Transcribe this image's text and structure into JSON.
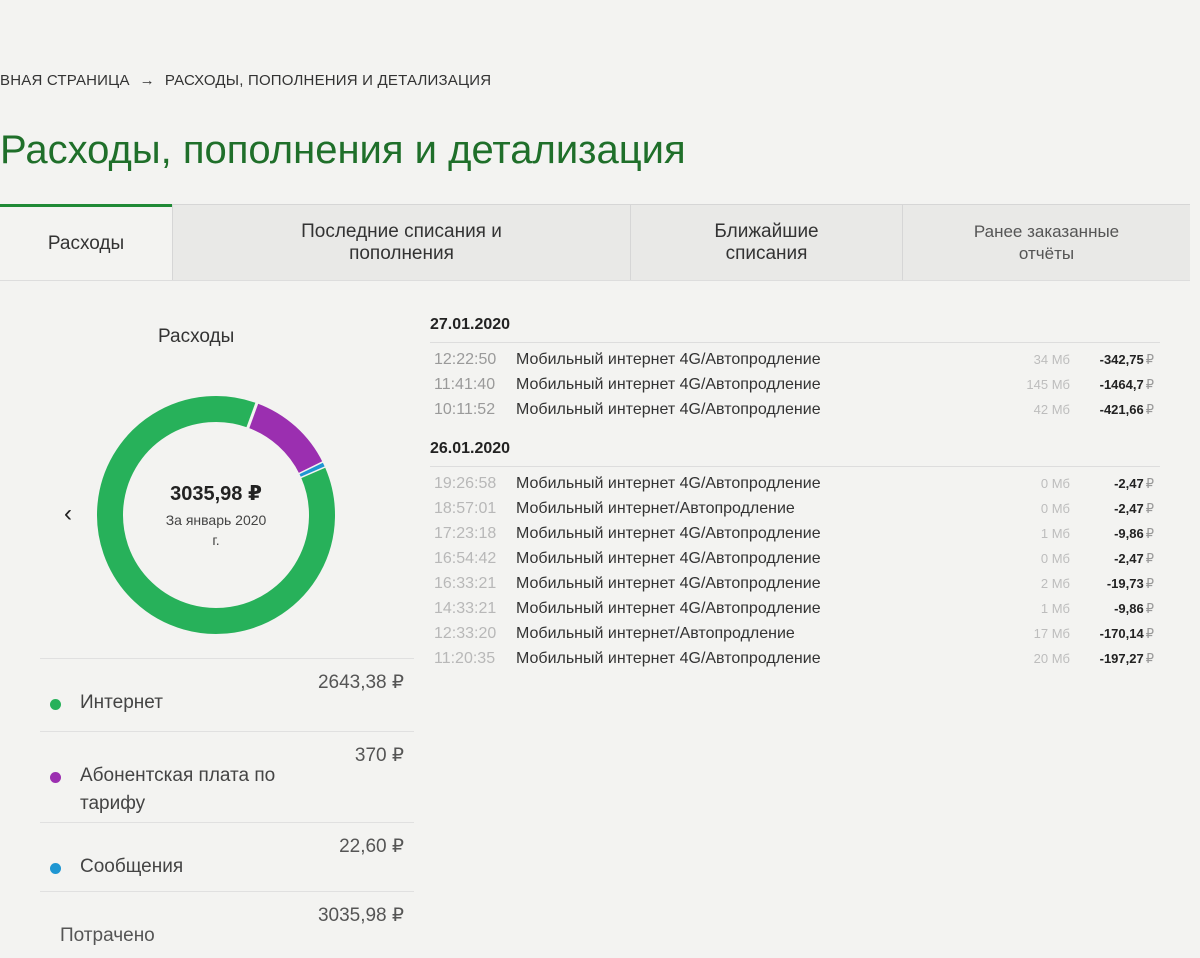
{
  "breadcrumb": {
    "home": "ВНАЯ СТРАНИЦА",
    "separator": "→",
    "current": "РАСХОДЫ, ПОПОЛНЕНИЯ И ДЕТАЛИЗАЦИЯ"
  },
  "page_title": "Расходы, пополнения и детализация",
  "tabs": [
    {
      "line1": "Расходы",
      "line2": ""
    },
    {
      "line1": "Последние списания и",
      "line2": "пополнения"
    },
    {
      "line1": "Ближайшие",
      "line2": "списания"
    },
    {
      "line1": "Ранее заказанные",
      "line2": "отчёты"
    }
  ],
  "summary": {
    "title": "Расходы",
    "total": "3035,98 ₽",
    "period": "За январь 2020 г.",
    "prev_icon": "chevron-left-icon"
  },
  "colors": {
    "internet": "#27b15a",
    "tariff": "#9b2fb0",
    "messages": "#1e96d2",
    "accent": "#1f6f2a"
  },
  "legend": [
    {
      "name": "Интернет",
      "value": "2643,38 ₽",
      "amount": 2643.38
    },
    {
      "name": "Абонентская плата по тарифу",
      "value": "370 ₽",
      "amount": 370
    },
    {
      "name": "Сообщения",
      "value": "22,60 ₽",
      "amount": 22.6
    },
    {
      "name": "Потрачено",
      "value": "3035,98 ₽"
    }
  ],
  "days": [
    {
      "date": "27.01.2020",
      "rows": [
        {
          "time": "12:22:50",
          "desc": "Мобильный интернет 4G/Автопродление",
          "vol": "34 Мб",
          "amount": "-342,75",
          "cur": "₽"
        },
        {
          "time": "11:41:40",
          "desc": "Мобильный интернет 4G/Автопродление",
          "vol": "145 Мб",
          "amount": "-1464,7",
          "cur": "₽"
        },
        {
          "time": "10:11:52",
          "desc": "Мобильный интернет 4G/Автопродление",
          "vol": "42 Мб",
          "amount": "-421,66",
          "cur": "₽"
        }
      ]
    },
    {
      "date": "26.01.2020",
      "rows": [
        {
          "time": "19:26:58",
          "desc": "Мобильный интернет 4G/Автопродление",
          "vol": "0 Мб",
          "amount": "-2,47",
          "cur": "₽"
        },
        {
          "time": "18:57:01",
          "desc": "Мобильный интернет/Автопродление",
          "vol": "0 Мб",
          "amount": "-2,47",
          "cur": "₽"
        },
        {
          "time": "17:23:18",
          "desc": "Мобильный интернет 4G/Автопродление",
          "vol": "1 Мб",
          "amount": "-9,86",
          "cur": "₽"
        },
        {
          "time": "16:54:42",
          "desc": "Мобильный интернет 4G/Автопродление",
          "vol": "0 Мб",
          "amount": "-2,47",
          "cur": "₽"
        },
        {
          "time": "16:33:21",
          "desc": "Мобильный интернет 4G/Автопродление",
          "vol": "2 Мб",
          "amount": "-19,73",
          "cur": "₽"
        },
        {
          "time": "14:33:21",
          "desc": "Мобильный интернет 4G/Автопродление",
          "vol": "1 Мб",
          "amount": "-9,86",
          "cur": "₽"
        },
        {
          "time": "12:33:20",
          "desc": "Мобильный интернет/Автопродление",
          "vol": "17 Мб",
          "amount": "-170,14",
          "cur": "₽"
        },
        {
          "time": "11:20:35",
          "desc": "Мобильный интернет 4G/Автопродление",
          "vol": "20 Мб",
          "amount": "-197,27",
          "cur": "₽"
        }
      ]
    }
  ]
}
